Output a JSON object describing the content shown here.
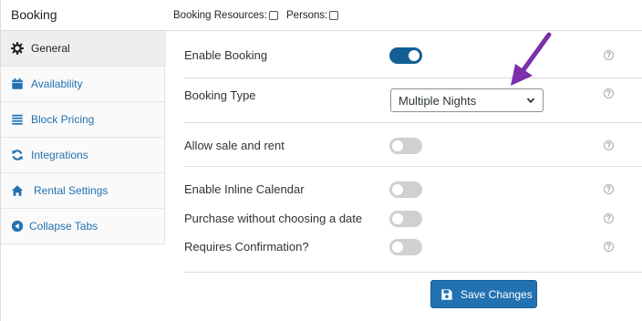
{
  "header": {
    "title": "Booking",
    "booking_resources_label": "Booking Resources:",
    "persons_label": "Persons:"
  },
  "sidebar": {
    "items": [
      {
        "label": "General",
        "icon": "gear-icon",
        "active": true
      },
      {
        "label": "Availability",
        "icon": "calendar-icon",
        "active": false
      },
      {
        "label": "Block Pricing",
        "icon": "list-icon",
        "active": false
      },
      {
        "label": "Integrations",
        "icon": "refresh-icon",
        "active": false
      },
      {
        "label": "Rental Settings",
        "icon": "home-icon",
        "active": false
      },
      {
        "label": "Collapse Tabs",
        "icon": "collapse-icon",
        "active": false
      }
    ]
  },
  "settings": {
    "enable_booking": {
      "label": "Enable Booking",
      "on": true
    },
    "booking_type": {
      "label": "Booking Type",
      "value": "Multiple Nights"
    },
    "allow_sale_rent": {
      "label": "Allow sale and rent",
      "on": false
    },
    "inline_calendar": {
      "label": "Enable Inline Calendar",
      "on": false
    },
    "purchase_without_date": {
      "label": "Purchase without choosing a date",
      "on": false
    },
    "requires_confirmation": {
      "label": "Requires Confirmation?",
      "on": false
    }
  },
  "help_glyph": "?",
  "save_button": {
    "label": "Save Changes",
    "icon": "floppy-disk-icon"
  },
  "colors": {
    "accent": "#2271b1",
    "toggle_on": "#135e96",
    "toggle_off": "#d0d0d0",
    "annotation_arrow": "#7b2fa8"
  }
}
